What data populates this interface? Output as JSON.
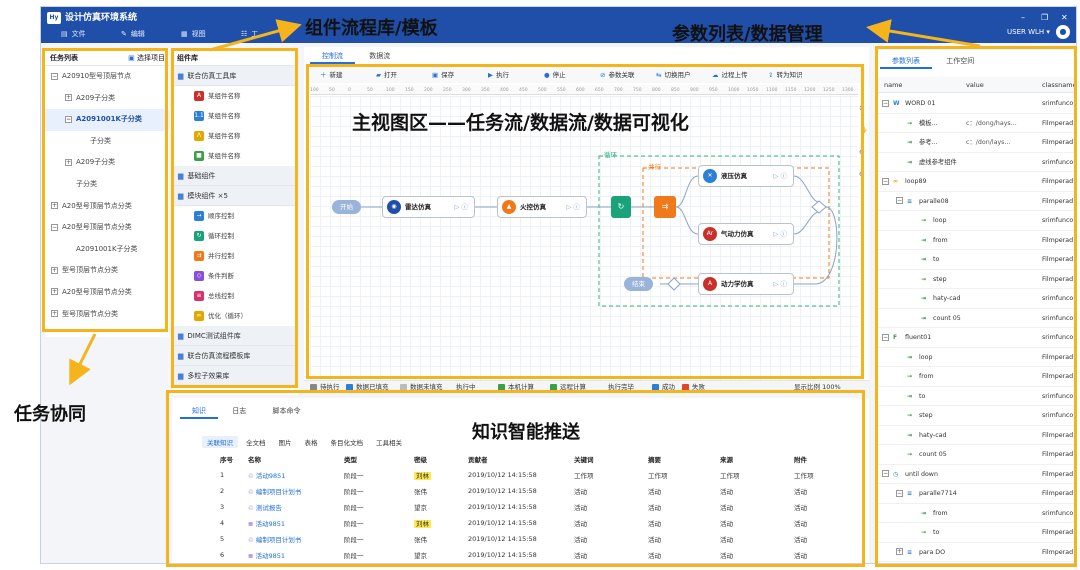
{
  "app": {
    "logo": "Hy",
    "title": "设计仿真环境系统",
    "user": "USER WLH ▾"
  },
  "menu": [
    {
      "icon": "file-icon",
      "label": "文件"
    },
    {
      "icon": "edit-icon",
      "label": "编辑"
    },
    {
      "icon": "view-icon",
      "label": "视图"
    },
    {
      "icon": "tool-icon",
      "label": "工"
    }
  ],
  "tasklist": {
    "title": "任务列表",
    "select": "选择项目",
    "items": [
      {
        "label": "A20910型号顶层节点",
        "depth": 0,
        "tog": "−"
      },
      {
        "label": "A209子分类",
        "depth": 1,
        "tog": "+"
      },
      {
        "label": "A2091001K子分类",
        "depth": 1,
        "tog": "−",
        "selected": true
      },
      {
        "label": "子分类",
        "depth": 2,
        "tog": ""
      },
      {
        "label": "A209子分类",
        "depth": 1,
        "tog": "+"
      },
      {
        "label": "子分类",
        "depth": 1,
        "tog": ""
      },
      {
        "label": "A20型号顶层节点分类",
        "depth": 0,
        "tog": "+"
      },
      {
        "label": "A20型号顶层节点分类",
        "depth": 0,
        "tog": "−"
      },
      {
        "label": "A2091001K子分类",
        "depth": 1,
        "tog": ""
      },
      {
        "label": "型号顶层节点分类",
        "depth": 0,
        "tog": "+"
      },
      {
        "label": "A20型号顶层节点分类",
        "depth": 0,
        "tog": "+"
      },
      {
        "label": "型号顶层节点分类",
        "depth": 0,
        "tog": "+"
      }
    ]
  },
  "library": {
    "title": "组件库",
    "groups": [
      {
        "label": "联合仿真工具库",
        "items": [
          {
            "label": "某组件名称",
            "color": "#c9302c",
            "g": "A"
          },
          {
            "label": "某组件名称",
            "color": "#2d7fd6",
            "g": "1.1"
          },
          {
            "label": "某组件名称",
            "color": "#e0a800",
            "g": "Λ"
          },
          {
            "label": "某组件名称",
            "color": "#3aa04a",
            "g": "■"
          }
        ]
      },
      {
        "label": "基础组件",
        "items": []
      },
      {
        "label": "模块组件 ×5",
        "items": [
          {
            "label": "顺序控制",
            "color": "#2d7fd6",
            "g": "→"
          },
          {
            "label": "循环控制",
            "color": "#1aa37a",
            "g": "↻"
          },
          {
            "label": "并行控制",
            "color": "#f07a1a",
            "g": "⇉"
          },
          {
            "label": "条件判断",
            "color": "#8a4fd6",
            "g": "◇"
          },
          {
            "label": "总线控制",
            "color": "#d6336c",
            "g": "≡"
          },
          {
            "label": "优化（循环）",
            "color": "#e0a800",
            "g": "∞"
          }
        ]
      },
      {
        "label": "DIMC测试组件库",
        "items": []
      },
      {
        "label": "联合仿真流程模板库",
        "items": []
      },
      {
        "label": "多粒子效果库",
        "items": []
      }
    ]
  },
  "workspace": {
    "tabs": [
      "控制流",
      "数据流"
    ],
    "toolbar": [
      {
        "icon": "plus-icon",
        "label": "新建"
      },
      {
        "icon": "folder-open-icon",
        "label": "打开"
      },
      {
        "icon": "save-icon",
        "label": "保存"
      },
      {
        "icon": "play-icon",
        "label": "执行"
      },
      {
        "icon": "stop-icon",
        "label": "停止"
      },
      {
        "icon": "link-icon",
        "label": "参数关联"
      },
      {
        "icon": "switch-user-icon",
        "label": "切换用户"
      },
      {
        "icon": "upload-icon",
        "label": "过程上传"
      },
      {
        "icon": "knowledge-icon",
        "label": "转为知识"
      }
    ],
    "ruler": [
      "100",
      "50",
      "0",
      "50",
      "100",
      "150",
      "200",
      "250",
      "300",
      "350",
      "400",
      "450",
      "500",
      "550",
      "600",
      "650",
      "700",
      "750",
      "800",
      "850",
      "900",
      "950",
      "1000",
      "1050",
      "1100",
      "1150",
      "1200",
      "1250",
      "1300"
    ],
    "flow": {
      "start": "开始",
      "end": "结束",
      "loop": "循环",
      "parallel": "并行",
      "nodes": [
        {
          "id": "radar",
          "label": "雷达仿真",
          "color": "#1f4fa8",
          "g": "◉"
        },
        {
          "id": "fire",
          "label": "火控仿真",
          "color": "#f07a1a",
          "g": "▲"
        },
        {
          "id": "hyd",
          "label": "液压仿真",
          "color": "#2d7fd6",
          "g": "✕"
        },
        {
          "id": "aero",
          "label": "气动力仿真",
          "color": "#c9302c",
          "g": "Ar"
        },
        {
          "id": "dyn",
          "label": "动力学仿真",
          "color": "#c9302c",
          "g": "A"
        }
      ],
      "ctrl": "▷ ⓘ"
    },
    "status": [
      {
        "label": "待执行",
        "color": "#888"
      },
      {
        "label": "数据已填充",
        "color": "#2d7fd6"
      },
      {
        "label": "数据未填充",
        "color": "#bbb"
      },
      {
        "label": "执行中",
        "color": ""
      },
      {
        "label": "本机计算",
        "color": "#3aa04a"
      },
      {
        "label": "远程计算",
        "color": "#3aa04a"
      },
      {
        "label": "执行完毕",
        "color": ""
      },
      {
        "label": "成功",
        "color": "#2d7fd6"
      },
      {
        "label": "失败",
        "color": "#e0452f"
      }
    ],
    "zoom": "显示比例 100%"
  },
  "knowledge": {
    "tabs": [
      "知识",
      "日志",
      "脚本命令"
    ],
    "subtabs": [
      "关联知识",
      "全文档",
      "图片",
      "表格",
      "条目化文档",
      "工具相关"
    ],
    "headers": [
      "序号",
      "名称",
      "类型",
      "密级",
      "贡献者",
      "关键词",
      "摘要",
      "来源",
      "附件"
    ],
    "rows": [
      [
        "1",
        "活动9851",
        "阶段一",
        "刘林",
        "2019/10/12 14:15:58",
        "工作项",
        "工作项",
        "工作项",
        "工作项"
      ],
      [
        "2",
        "编制项目计划书",
        "阶段一",
        "张伟",
        "2019/10/12 14:15:58",
        "活动",
        "活动",
        "活动",
        "活动"
      ],
      [
        "3",
        "测试报告",
        "阶段一",
        "望京",
        "2019/10/12 14:15:58",
        "活动",
        "活动",
        "活动",
        "活动"
      ],
      [
        "4",
        "活动9851",
        "阶段一",
        "刘林",
        "2019/10/12 14:15:58",
        "活动",
        "活动",
        "活动",
        "活动"
      ],
      [
        "5",
        "编制项目计划书",
        "阶段一",
        "张伟",
        "2019/10/12 14:15:58",
        "活动",
        "活动",
        "活动",
        "活动"
      ],
      [
        "6",
        "活动9851",
        "阶段一",
        "望京",
        "2019/10/12 14:15:58",
        "活动",
        "活动",
        "活动",
        "活动"
      ]
    ],
    "highlight": "刘林"
  },
  "params": {
    "tabs": [
      "参数列表",
      "工作空间"
    ],
    "headers": [
      "name",
      "value",
      "classname"
    ],
    "rows": [
      {
        "d": 0,
        "t": "−",
        "ic": "W",
        "icc": "#2d7fd6",
        "name": "WORD 01",
        "value": "",
        "cls": "srimfunco"
      },
      {
        "d": 1,
        "t": "",
        "ic": "→",
        "icc": "#3aa04a",
        "name": "模板...",
        "value": "c：/dong/hays...",
        "cls": "Filmperad"
      },
      {
        "d": 1,
        "t": "",
        "ic": "⇥",
        "icc": "#3aa04a",
        "name": "参考...",
        "value": "c：/don/lays...",
        "cls": "Filmperad"
      },
      {
        "d": 1,
        "t": "",
        "ic": "⇥",
        "icc": "#3aa04a",
        "name": "虚线参考组件",
        "value": "",
        "cls": "srimfunco"
      },
      {
        "d": 0,
        "t": "−",
        "ic": "∞",
        "icc": "#e0a800",
        "name": "loop89",
        "value": "",
        "cls": "Filmperad"
      },
      {
        "d": 1,
        "t": "−",
        "ic": "≡",
        "icc": "#2d7fd6",
        "name": "paralle08",
        "value": "",
        "cls": "Filmperad"
      },
      {
        "d": 2,
        "t": "",
        "ic": "→",
        "icc": "#3aa04a",
        "name": "loop",
        "value": "",
        "cls": "srimfunco"
      },
      {
        "d": 2,
        "t": "",
        "ic": "⇥",
        "icc": "#3aa04a",
        "name": "from",
        "value": "",
        "cls": "Filmperad"
      },
      {
        "d": 2,
        "t": "",
        "ic": "⇥",
        "icc": "#3aa04a",
        "name": "to",
        "value": "",
        "cls": "Filmperad"
      },
      {
        "d": 2,
        "t": "",
        "ic": "→",
        "icc": "#3aa04a",
        "name": "step",
        "value": "",
        "cls": "Filmperad"
      },
      {
        "d": 2,
        "t": "",
        "ic": "⇥",
        "icc": "#3aa04a",
        "name": "haty-cad",
        "value": "",
        "cls": "srimfunco"
      },
      {
        "d": 2,
        "t": "",
        "ic": "⇥",
        "icc": "#3aa04a",
        "name": "count 05",
        "value": "",
        "cls": "srimfunco"
      },
      {
        "d": 0,
        "t": "−",
        "ic": "F",
        "icc": "#3aa04a",
        "name": "fluent01",
        "value": "",
        "cls": "srimfunco"
      },
      {
        "d": 1,
        "t": "",
        "ic": "⇥",
        "icc": "#3aa04a",
        "name": "loop",
        "value": "",
        "cls": "Filmperad"
      },
      {
        "d": 1,
        "t": "",
        "ic": "→",
        "icc": "#3aa04a",
        "name": "from",
        "value": "",
        "cls": "Filmperad"
      },
      {
        "d": 1,
        "t": "",
        "ic": "⇥",
        "icc": "#3aa04a",
        "name": "to",
        "value": "",
        "cls": "srimfunco"
      },
      {
        "d": 1,
        "t": "",
        "ic": "→",
        "icc": "#3aa04a",
        "name": "step",
        "value": "",
        "cls": "srimfunco"
      },
      {
        "d": 1,
        "t": "",
        "ic": "⇥",
        "icc": "#3aa04a",
        "name": "haty-cad",
        "value": "",
        "cls": "Filmperad"
      },
      {
        "d": 1,
        "t": "",
        "ic": "→",
        "icc": "#3aa04a",
        "name": "count 05",
        "value": "",
        "cls": "Filmperad"
      },
      {
        "d": 0,
        "t": "−",
        "ic": "◷",
        "icc": "#2d7fd6",
        "name": "until down",
        "value": "",
        "cls": "Filmperad"
      },
      {
        "d": 1,
        "t": "−",
        "ic": "≡",
        "icc": "#2d7fd6",
        "name": "paralle7714",
        "value": "",
        "cls": "Filmperad"
      },
      {
        "d": 2,
        "t": "",
        "ic": "⇥",
        "icc": "#3aa04a",
        "name": "from",
        "value": "",
        "cls": "srimfunco"
      },
      {
        "d": 2,
        "t": "",
        "ic": "→",
        "icc": "#3aa04a",
        "name": "to",
        "value": "",
        "cls": "Filmperad"
      },
      {
        "d": 1,
        "t": "+",
        "ic": "≡",
        "icc": "#2d7fd6",
        "name": "para DO",
        "value": "",
        "cls": "Filmperad"
      }
    ]
  },
  "annotations": {
    "library": "组件流程库/模板",
    "params": "参数列表/数据管理",
    "main": "主视图区——任务流/数据流/数据可视化",
    "tasks": "任务协同",
    "knowledge": "知识智能推送"
  },
  "colors": {
    "accent": "#f5b31c",
    "brand": "#1f4fa8",
    "link": "#1f6fe0"
  }
}
